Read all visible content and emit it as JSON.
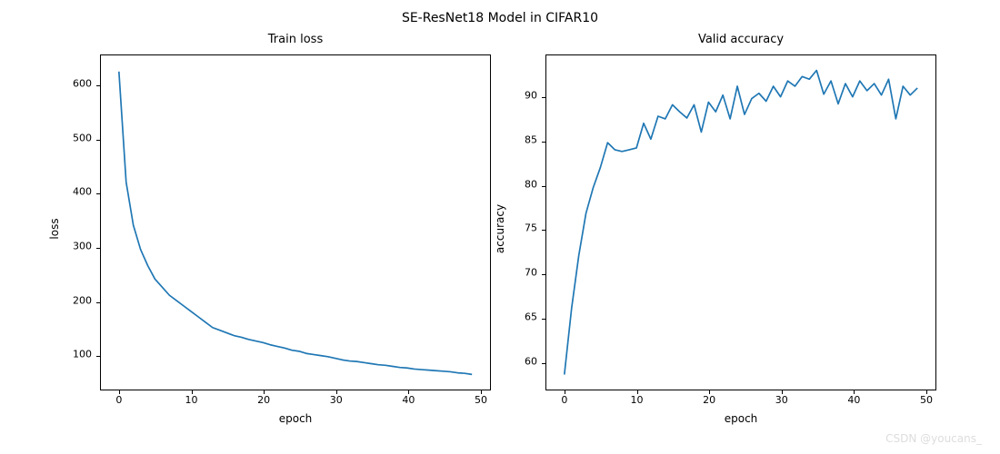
{
  "suptitle": "SE-ResNet18 Model in CIFAR10",
  "watermark": "CSDN @youcans_",
  "chart_data": [
    {
      "type": "line",
      "title": "Train loss",
      "xlabel": "epoch",
      "ylabel": "loss",
      "xlim": [
        -2.5,
        51.5
      ],
      "ylim": [
        35,
        655
      ],
      "xticks": [
        0,
        10,
        20,
        30,
        40,
        50
      ],
      "yticks": [
        100,
        200,
        300,
        400,
        500,
        600
      ],
      "x": [
        0,
        1,
        2,
        3,
        4,
        5,
        6,
        7,
        8,
        9,
        10,
        11,
        12,
        13,
        14,
        15,
        16,
        17,
        18,
        19,
        20,
        21,
        22,
        23,
        24,
        25,
        26,
        27,
        28,
        29,
        30,
        31,
        32,
        33,
        34,
        35,
        36,
        37,
        38,
        39,
        40,
        41,
        42,
        43,
        44,
        45,
        46,
        47,
        48,
        49
      ],
      "y": [
        625,
        420,
        340,
        295,
        265,
        240,
        225,
        210,
        200,
        190,
        180,
        170,
        160,
        150,
        145,
        140,
        135,
        132,
        128,
        125,
        122,
        118,
        115,
        112,
        108,
        106,
        102,
        100,
        98,
        96,
        93,
        90,
        88,
        87,
        85,
        83,
        81,
        80,
        78,
        76,
        75,
        73,
        72,
        71,
        70,
        69,
        68,
        66,
        65,
        63
      ]
    },
    {
      "type": "line",
      "title": "Valid accuracy",
      "xlabel": "epoch",
      "ylabel": "accuracy",
      "xlim": [
        -2.5,
        51.5
      ],
      "ylim": [
        56.8,
        94.7
      ],
      "xticks": [
        0,
        10,
        20,
        30,
        40,
        50
      ],
      "yticks": [
        60,
        65,
        70,
        75,
        80,
        85,
        90
      ],
      "x": [
        0,
        1,
        2,
        3,
        4,
        5,
        6,
        7,
        8,
        9,
        10,
        11,
        12,
        13,
        14,
        15,
        16,
        17,
        18,
        19,
        20,
        21,
        22,
        23,
        24,
        25,
        26,
        27,
        28,
        29,
        30,
        31,
        32,
        33,
        34,
        35,
        36,
        37,
        38,
        39,
        40,
        41,
        42,
        43,
        44,
        45,
        46,
        47,
        48,
        49
      ],
      "y": [
        58.5,
        66.0,
        72.0,
        76.8,
        79.7,
        82.0,
        84.8,
        84.0,
        83.8,
        84.0,
        84.2,
        87.0,
        85.2,
        87.8,
        87.5,
        89.1,
        88.3,
        87.6,
        89.1,
        86.0,
        89.4,
        88.3,
        90.2,
        87.5,
        91.2,
        88.0,
        89.8,
        90.4,
        89.5,
        91.2,
        90.0,
        91.8,
        91.2,
        92.3,
        92.0,
        93.0,
        90.3,
        91.8,
        89.2,
        91.5,
        90.0,
        91.8,
        90.7,
        91.5,
        90.2,
        92.0,
        87.5,
        91.2,
        90.2,
        91.0
      ]
    }
  ]
}
